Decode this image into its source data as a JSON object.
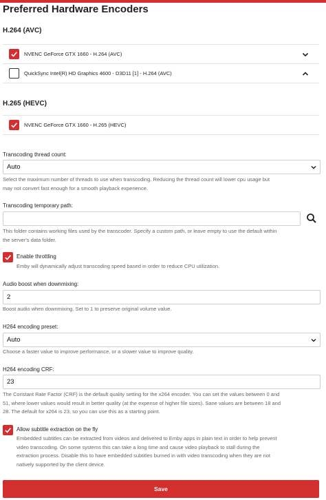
{
  "page": {
    "title": "Preferred Hardware Encoders",
    "accent_color": "#d32f2f"
  },
  "h264": {
    "title": "H.264 (AVC)",
    "encoders": [
      {
        "label": "NVENC GeForce GTX 1660 - H.264 (AVC)",
        "checked": true,
        "arrow": "chevron-down-icon"
      },
      {
        "label": "QuickSync Intel(R) HD Graphics 4600 - D3D11 [1] - H.264 (AVC)",
        "checked": false,
        "arrow": "chevron-up-icon"
      }
    ]
  },
  "h265": {
    "title": "H.265 (HEVC)",
    "encoders": [
      {
        "label": "NVENC GeForce GTX 1660 - H.265 (HEVC)",
        "checked": true
      }
    ]
  },
  "thread_count": {
    "label": "Transcoding thread count:",
    "value": "Auto",
    "help_line1": "Select the maximum number of threads to use when transcoding. Reducing the thread count will lower cpu usage but",
    "help_line2": "may not convert fast enough for a smooth playback experience."
  },
  "temp_path": {
    "label": "Transcoding temporary path:",
    "value": "",
    "help_line1": "This folder contains working files used by the transcoder. Specify a custom path, or leave empty to use the default within",
    "help_line2": "the server's data folder."
  },
  "throttling": {
    "label": "Enable throttling",
    "checked": true,
    "help": "Emby will dynamically adjust transcoding speed based in order to reduce CPU utilization."
  },
  "audio_boost": {
    "label": "Audio boost when downmixing:",
    "value": "2",
    "help": "Boost audio when downmixing. Set to 1 to preserve original volume value."
  },
  "h264_preset": {
    "label": "H264 encoding preset:",
    "value": "Auto",
    "help": "Choose a faster value to improve performance, or a slower value to improve quality."
  },
  "h264_crf": {
    "label": "H264 encoding CRF:",
    "value": "23",
    "help_line1": "The Constant Rate Factor (CRF) is the default quality setting for the x264 encoder. You can set the values between 0 and",
    "help_line2": "51, where lower values would result in better quality (at the expense of higher file sizes). Sane values are between 18 and",
    "help_line3": "28. The default for x264 is 23, so you can use this as a starting point."
  },
  "subtitle_extraction": {
    "label": "Allow subtitle extraction on the fly",
    "checked": true,
    "help_line1": "Embedded subtitles can be extracted from videos and delivered to Emby apps in plain text in order to help prevent",
    "help_line2": "video transcoding. On some systems this can take a long time and cause video playback to stall during the",
    "help_line3": "extraction process. Disable this to have embedded subtitles burned in with video transcoding when they are not",
    "help_line4": "natively supported by the client device."
  },
  "save_label": "Save"
}
